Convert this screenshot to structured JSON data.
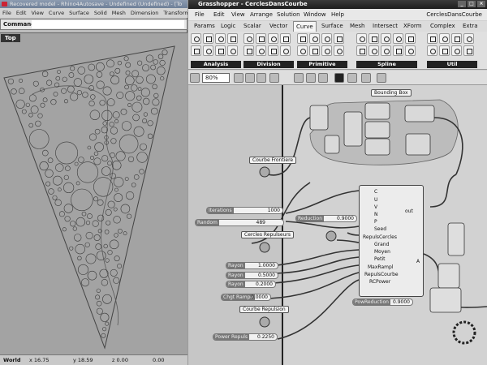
{
  "rhino": {
    "title": "Recovered model - Rhino4Autosave - Undefined (Undefined) - [To",
    "menu": [
      "File",
      "Edit",
      "View",
      "Curve",
      "Surface",
      "Solid",
      "Mesh",
      "Dimension",
      "Transform",
      "To"
    ],
    "command_label": "Command:",
    "viewport_label": "Top",
    "status": {
      "cplane": "World",
      "x": "x 16.75",
      "y": "y 18.59",
      "z": "z 0.00",
      "extra": "0.00"
    }
  },
  "grasshopper": {
    "title": "Grasshopper - CerclesDansCourbe",
    "menu": [
      "File",
      "Edit",
      "View",
      "Arrange",
      "Solution",
      "Window",
      "Help"
    ],
    "document_name": "CerclesDansCourbe",
    "tabs": [
      "Params",
      "Logic",
      "Scalar",
      "Vector",
      "Curve",
      "Surface",
      "Mesh",
      "Intersect",
      "XForm",
      "Complex",
      "Extra"
    ],
    "active_tab": "Curve",
    "ribbon_groups": [
      "Analysis",
      "Division",
      "Primitive",
      "Spline",
      "Util"
    ],
    "zoom": "80%",
    "canvas": {
      "labels": {
        "bounding_box": "Bounding Box",
        "courbe_frontiere": "Courbe Frontiere",
        "cercles_repulseurs": "Cercles Repulseurs",
        "courbe_repulsion": "Courbe Repulsion"
      },
      "sliders": [
        {
          "name": "Iterations",
          "value": "1000"
        },
        {
          "name": "Random",
          "value": "489"
        },
        {
          "name": "Reduction",
          "value": "0.9000"
        },
        {
          "name": "Rayon",
          "value": "1.0000"
        },
        {
          "name": "Rayon",
          "value": "0.5000"
        },
        {
          "name": "Rayon",
          "value": "0.2000"
        },
        {
          "name": "Chgt Rampe",
          "value": "0.0000"
        },
        {
          "name": "Power Repuls",
          "value": "0.2250"
        },
        {
          "name": "PowReduction",
          "value": "0.9000"
        }
      ],
      "cluster_inputs": [
        "C",
        "U",
        "V",
        "N",
        "P",
        "Seed",
        "RepulsCercles",
        "Grand",
        "Moyen",
        "Petit",
        "MaxRampl",
        "RepulsCourbe",
        "RCPower"
      ],
      "cluster_output": "out",
      "cluster_output_a": "A"
    }
  }
}
